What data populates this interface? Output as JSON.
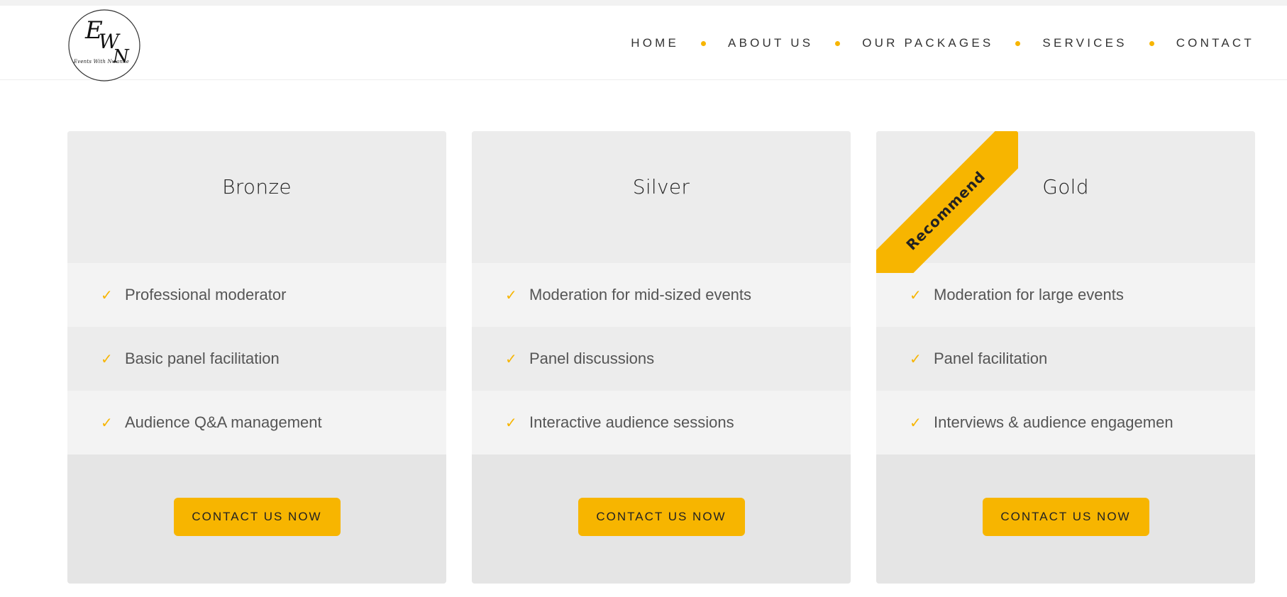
{
  "brand": {
    "logo_tagline": "Events With Nwanne",
    "accent_color": "#f7b500"
  },
  "nav": {
    "items": [
      "Home",
      "About Us",
      "Our Packages",
      "Services",
      "Contact"
    ]
  },
  "packages": [
    {
      "name": "Bronze",
      "features": [
        "Professional moderator",
        "Basic panel facilitation",
        "Audience Q&A management"
      ],
      "cta": "Contact Us Now",
      "ribbon": ""
    },
    {
      "name": "Silver",
      "features": [
        "Moderation for mid-sized events",
        "Panel discussions",
        "Interactive audience sessions"
      ],
      "cta": "Contact Us Now",
      "ribbon": ""
    },
    {
      "name": "Gold",
      "features": [
        "Moderation for large events",
        "Panel facilitation",
        "Interviews & audience engagemen"
      ],
      "cta": "Contact Us Now",
      "ribbon": "Recommend"
    }
  ],
  "icons": {
    "check": "✓",
    "logo": "ewn-monogram-logo"
  }
}
